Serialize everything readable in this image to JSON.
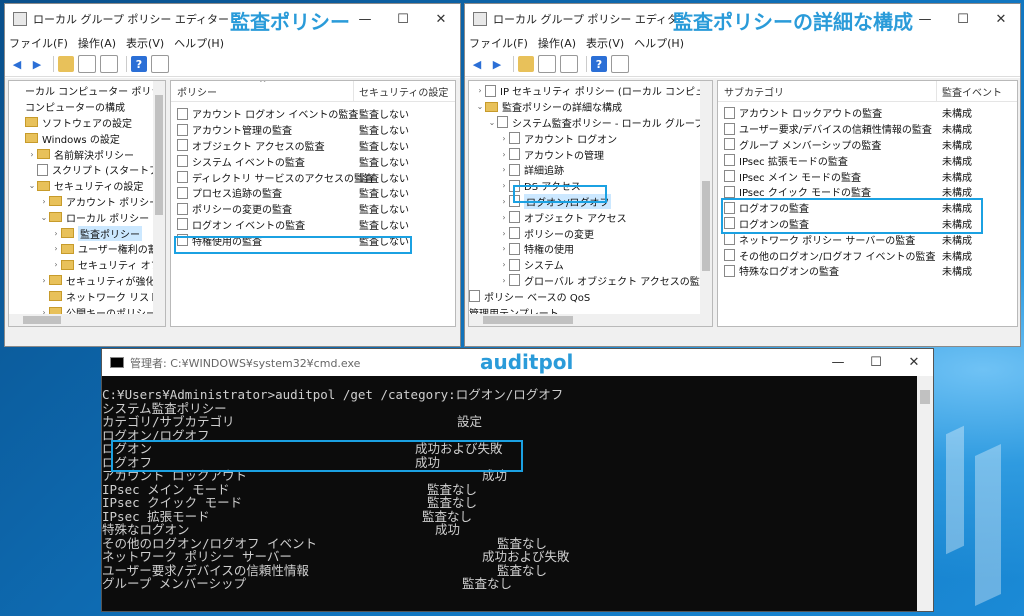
{
  "left_window": {
    "title": "ローカル グループ ポリシー エディター",
    "overlay_title": "監査ポリシー",
    "menu": [
      "ファイル(F)",
      "操作(A)",
      "表示(V)",
      "ヘルプ(H)"
    ],
    "tree": [
      {
        "label": "ーカル コンピューター ポリシー",
        "arrow": "",
        "indent": 0,
        "icon": "none"
      },
      {
        "label": "コンピューターの構成",
        "arrow": "",
        "indent": 0,
        "icon": "none"
      },
      {
        "label": "ソフトウェアの設定",
        "arrow": "",
        "indent": 0,
        "icon": "folder"
      },
      {
        "label": "Windows の設定",
        "arrow": "",
        "indent": 0,
        "icon": "folder"
      },
      {
        "label": "名前解決ポリシー",
        "arrow": "›",
        "indent": 1,
        "icon": "folder"
      },
      {
        "label": "スクリプト (スタートアップ/シ",
        "arrow": "",
        "indent": 1,
        "icon": "doc"
      },
      {
        "label": "セキュリティの設定",
        "arrow": "⌄",
        "indent": 1,
        "icon": "folder"
      },
      {
        "label": "アカウント ポリシー",
        "arrow": "›",
        "indent": 2,
        "icon": "folder"
      },
      {
        "label": "ローカル ポリシー",
        "arrow": "⌄",
        "indent": 2,
        "icon": "folder"
      },
      {
        "label": "監査ポリシー",
        "arrow": "›",
        "indent": 3,
        "icon": "folder",
        "selected": true
      },
      {
        "label": "ユーザー権利の割",
        "arrow": "›",
        "indent": 3,
        "icon": "folder"
      },
      {
        "label": "セキュリティ オプシ",
        "arrow": "›",
        "indent": 3,
        "icon": "folder"
      },
      {
        "label": "セキュリティが強化され",
        "arrow": "›",
        "indent": 2,
        "icon": "folder"
      },
      {
        "label": "ネットワーク リスト マネ",
        "arrow": "",
        "indent": 2,
        "icon": "folder"
      },
      {
        "label": "公開キーのポリシー",
        "arrow": "›",
        "indent": 2,
        "icon": "folder"
      }
    ],
    "col_policy": "ポリシー",
    "col_setting": "セキュリティの設定",
    "rows": [
      {
        "name": "アカウント ログオン イベントの監査",
        "value": "監査しない"
      },
      {
        "name": "アカウント管理の監査",
        "value": "監査しない"
      },
      {
        "name": "オブジェクト アクセスの監査",
        "value": "監査しない"
      },
      {
        "name": "システム イベントの監査",
        "value": "監査しない"
      },
      {
        "name": "ディレクトリ サービスのアクセスの監査",
        "value": "監査しない"
      },
      {
        "name": "プロセス追跡の監査",
        "value": "監査しない"
      },
      {
        "name": "ポリシーの変更の監査",
        "value": "監査しない"
      },
      {
        "name": "ログオン イベントの監査",
        "value": "監査しない"
      },
      {
        "name": "特権使用の監査",
        "value": "監査しない"
      }
    ]
  },
  "right_window": {
    "title": "ローカル グループ ポリシー エディター",
    "overlay_title": "監査ポリシーの詳細な構成",
    "menu": [
      "ファイル(F)",
      "操作(A)",
      "表示(V)",
      "ヘルプ(H)"
    ],
    "tree": [
      {
        "label": "IP セキュリティ ポリシー (ローカル コンピューター)",
        "arrow": "›",
        "indent": 0,
        "icon": "doc"
      },
      {
        "label": "監査ポリシーの詳細な構成",
        "arrow": "⌄",
        "indent": 0,
        "icon": "folder"
      },
      {
        "label": "システム監査ポリシー - ローカル グループ ポリシ",
        "arrow": "⌄",
        "indent": 1,
        "icon": "doc"
      },
      {
        "label": "アカウント ログオン",
        "arrow": "›",
        "indent": 2,
        "icon": "doc"
      },
      {
        "label": "アカウントの管理",
        "arrow": "›",
        "indent": 2,
        "icon": "doc"
      },
      {
        "label": "詳細追跡",
        "arrow": "›",
        "indent": 2,
        "icon": "doc"
      },
      {
        "label": "DS アクセス",
        "arrow": "›",
        "indent": 2,
        "icon": "doc"
      },
      {
        "label": "ログオン/ログオフ",
        "arrow": "›",
        "indent": 2,
        "icon": "doc",
        "selected": true
      },
      {
        "label": "オブジェクト アクセス",
        "arrow": "›",
        "indent": 2,
        "icon": "doc"
      },
      {
        "label": "ポリシーの変更",
        "arrow": "›",
        "indent": 2,
        "icon": "doc"
      },
      {
        "label": "特権の使用",
        "arrow": "›",
        "indent": 2,
        "icon": "doc"
      },
      {
        "label": "システム",
        "arrow": "›",
        "indent": 2,
        "icon": "doc"
      },
      {
        "label": "グローバル オブジェクト アクセスの監査",
        "arrow": "›",
        "indent": 2,
        "icon": "doc"
      },
      {
        "label": "ポリシー ベースの QoS",
        "arrow": "",
        "indent": -1,
        "icon": "doc"
      },
      {
        "label": "管理用テンプレート",
        "arrow": "",
        "indent": -1,
        "icon": "none"
      }
    ],
    "col_sub": "サブカテゴリ",
    "col_event": "監査イベント",
    "rows": [
      {
        "name": "アカウント ロックアウトの監査",
        "value": "未構成"
      },
      {
        "name": "ユーザー要求/デバイスの信頼性情報の監査",
        "value": "未構成"
      },
      {
        "name": "グループ メンバーシップの監査",
        "value": "未構成"
      },
      {
        "name": "IPsec 拡張モードの監査",
        "value": "未構成"
      },
      {
        "name": "IPsec メイン モードの監査",
        "value": "未構成"
      },
      {
        "name": "IPsec クイック モードの監査",
        "value": "未構成"
      },
      {
        "name": "ログオフの監査",
        "value": "未構成"
      },
      {
        "name": "ログオンの監査",
        "value": "未構成"
      },
      {
        "name": "ネットワーク ポリシー サーバーの監査",
        "value": "未構成"
      },
      {
        "name": "その他のログオン/ログオフ イベントの監査",
        "value": "未構成"
      },
      {
        "name": "特殊なログオンの監査",
        "value": "未構成"
      }
    ]
  },
  "cmd_window": {
    "title": "管理者: C:¥WINDOWS¥system32¥cmd.exe",
    "overlay_title": "auditpol",
    "lines": [
      {
        "text": "C:¥Users¥Administrator>auditpol /get /category:ログオン/ログオフ",
        "value": ""
      },
      {
        "text": "システム監査ポリシー",
        "value": ""
      },
      {
        "text": "カテゴリ/サブカテゴリ",
        "value": "設定"
      },
      {
        "text": "ログオン/ログオフ",
        "value": ""
      },
      {
        "text": "  ログオン",
        "value": "成功および失敗"
      },
      {
        "text": "  ログオフ",
        "value": "成功"
      },
      {
        "text": "  アカウント ロックアウト",
        "value": "成功"
      },
      {
        "text": "  IPsec メイン モード",
        "value": "監査なし"
      },
      {
        "text": "  IPsec クイック モード",
        "value": "監査なし"
      },
      {
        "text": "  IPsec 拡張モード",
        "value": "監査なし"
      },
      {
        "text": "  特殊なログオン",
        "value": "成功"
      },
      {
        "text": "  その他のログオン/ログオフ イベント",
        "value": "監査なし"
      },
      {
        "text": "  ネットワーク ポリシー サーバー",
        "value": "成功および失敗"
      },
      {
        "text": "  ユーザー要求/デバイスの信頼性情報",
        "value": "監査なし"
      },
      {
        "text": "  グループ メンバーシップ",
        "value": "監査なし"
      }
    ]
  },
  "colors": {
    "highlight": "#1ba1e2",
    "overlay_text": "#2a9bd9"
  }
}
